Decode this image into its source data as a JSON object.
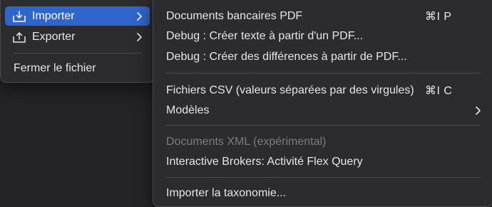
{
  "primary_menu": {
    "items": [
      {
        "label": "Importer",
        "icon": "import-tray-icon",
        "has_submenu": true,
        "highlighted": true
      },
      {
        "label": "Exporter",
        "icon": "export-tray-icon",
        "has_submenu": true,
        "highlighted": false
      }
    ],
    "close_file_label": "Fermer le fichier"
  },
  "import_submenu": {
    "pdf_bank_documents": {
      "label": "Documents bancaires PDF",
      "shortcut": "⌘I P"
    },
    "debug_text_from_pdf": {
      "label": "Debug : Créer texte à partir d'un PDF..."
    },
    "debug_diff_from_pdf": {
      "label": "Debug : Créer des différences à partir de PDF..."
    },
    "csv_files": {
      "label": "Fichiers CSV (valeurs séparées par des virgules)",
      "shortcut": "⌘I C"
    },
    "templates": {
      "label": "Modèles",
      "has_submenu": true
    },
    "xml_documents": {
      "label": "Documents XML (expérimental)",
      "disabled": true
    },
    "interactive_brokers": {
      "label": "Interactive Brokers: Activité Flex Query"
    },
    "import_taxonomy": {
      "label": "Importer la taxonomie..."
    }
  },
  "colors": {
    "highlight": "#2f66cd",
    "menu_bg": "#2c2c2e",
    "text": "#e6e6e7",
    "disabled_text": "#7c7c80",
    "separator": "#4a4a4c"
  }
}
